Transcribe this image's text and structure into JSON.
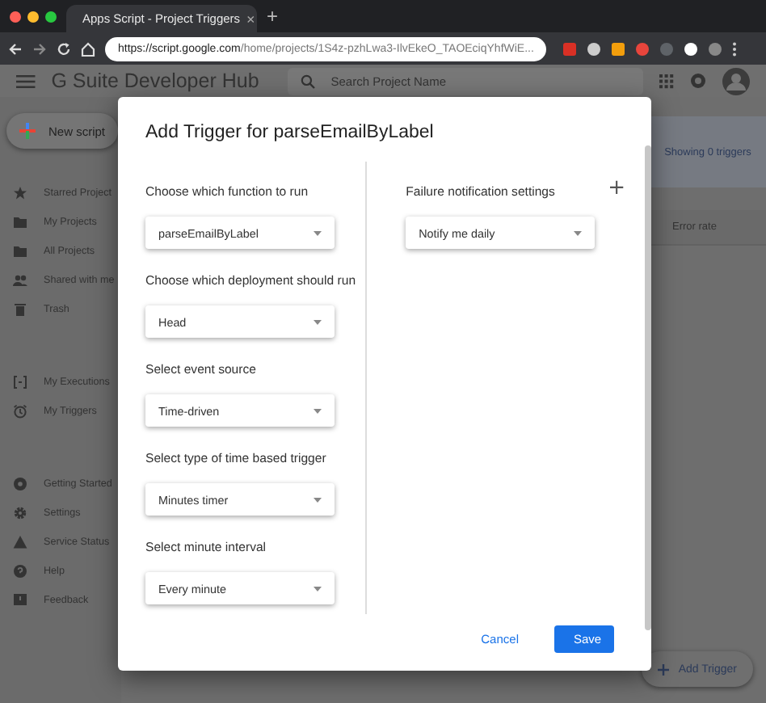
{
  "browser": {
    "tab_title": "Apps Script - Project Triggers",
    "tab_close": "×",
    "new_tab": "+",
    "url_host": "https://script.google.com",
    "url_path": "/home/projects/1S4z-pzhLwa3-IlvEkeO_TAOEciqYhfWiE..."
  },
  "header": {
    "title": "G Suite Developer Hub",
    "search_placeholder": "Search Project Name"
  },
  "new_script": "New script",
  "sidebar": {
    "groups": [
      [
        {
          "label": "Starred Project"
        },
        {
          "label": "My Projects"
        },
        {
          "label": "All Projects"
        },
        {
          "label": "Shared with me"
        },
        {
          "label": "Trash"
        }
      ],
      [
        {
          "label": "My Executions"
        },
        {
          "label": "My Triggers"
        }
      ],
      [
        {
          "label": "Getting Started"
        },
        {
          "label": "Settings"
        },
        {
          "label": "Service Status"
        },
        {
          "label": "Help"
        },
        {
          "label": "Feedback"
        }
      ]
    ]
  },
  "triggers_panel": {
    "count_text": "Showing 0 triggers",
    "columns": [
      "Error rate"
    ],
    "add_button": "Add Trigger"
  },
  "dialog": {
    "title": "Add Trigger for parseEmailByLabel",
    "left_fields": [
      {
        "label": "Choose which function to run",
        "value": "parseEmailByLabel"
      },
      {
        "label": "Choose which deployment should run",
        "value": "Head"
      },
      {
        "label": "Select event source",
        "value": "Time-driven"
      },
      {
        "label": "Select type of time based trigger",
        "value": "Minutes timer"
      },
      {
        "label": "Select minute interval",
        "value": "Every minute"
      }
    ],
    "right_fields": [
      {
        "label": "Failure notification settings",
        "value": "Notify me daily",
        "add": "+"
      }
    ],
    "buttons": [
      {
        "label": "Cancel",
        "kind": "text"
      },
      {
        "label": "Save",
        "kind": "primary"
      }
    ]
  }
}
